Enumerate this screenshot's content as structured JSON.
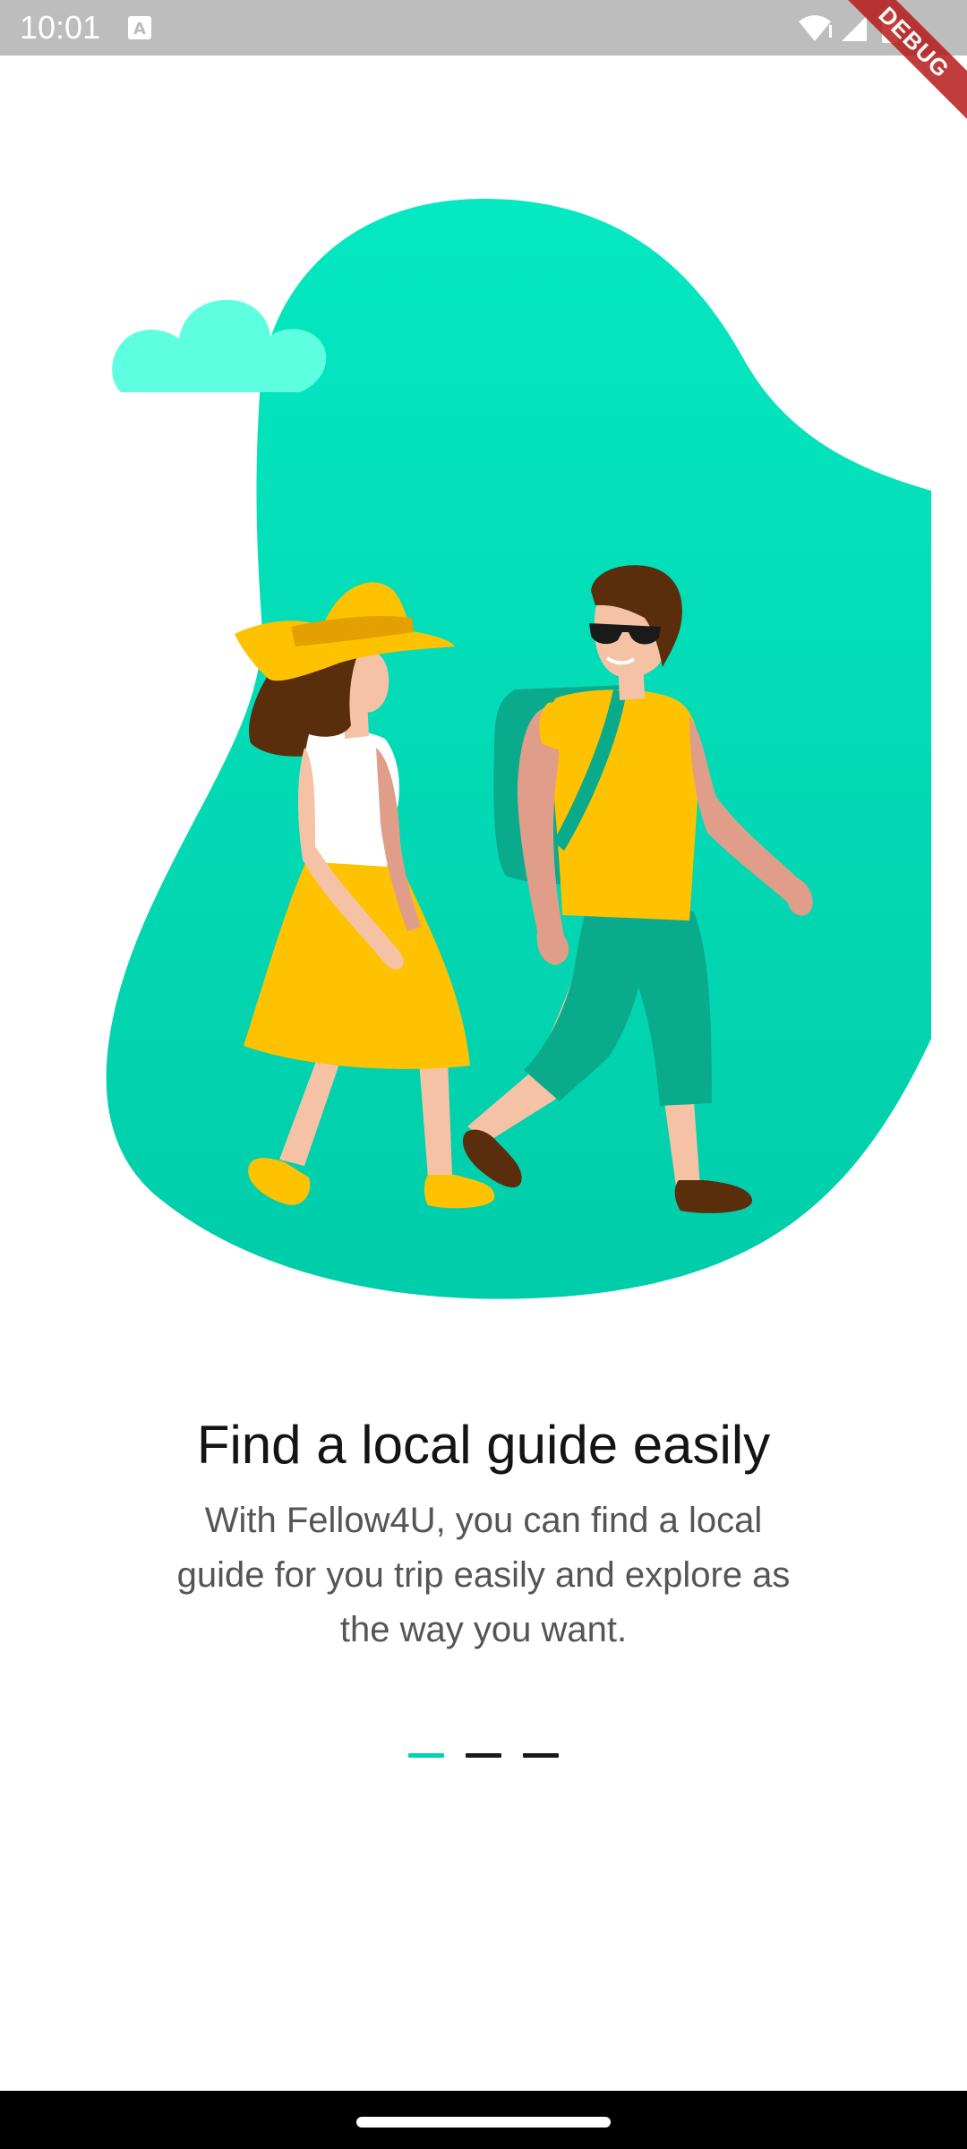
{
  "status_bar": {
    "time": "10:01",
    "debug_label": "DEBUG",
    "icons": [
      "a-keyboard-icon",
      "wifi-icon",
      "signal-icon",
      "battery-icon"
    ]
  },
  "onboarding": {
    "title": "Find a local guide easily",
    "description": "With Fellow4U, you can find a local guide for you trip easily and explore as the way you want.",
    "page_index": 0,
    "page_count": 3
  },
  "colors": {
    "accent": "#00d4b0",
    "blob": "#04dbb5",
    "cloud": "#5effe0",
    "yellow": "#fec200",
    "teal_dark": "#0aab8c",
    "skin": "#f6c2a6",
    "skin_dark": "#e09e8a",
    "hair": "#5a2d0c"
  }
}
